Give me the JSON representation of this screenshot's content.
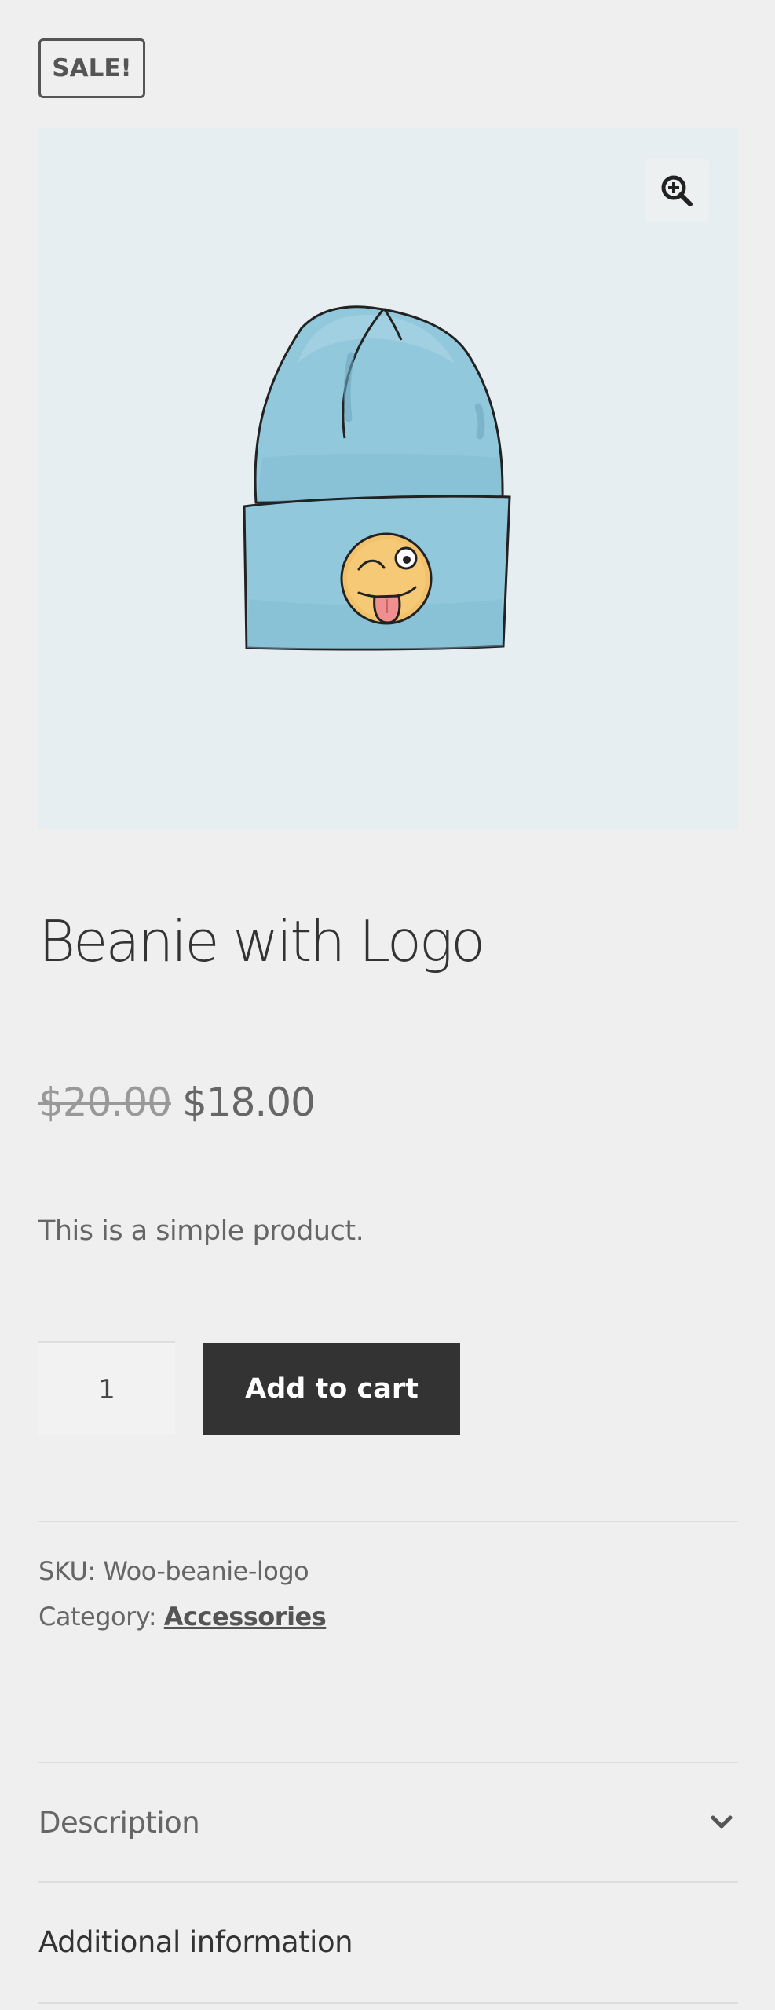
{
  "badge": {
    "sale_label": "SALE!"
  },
  "gallery": {
    "zoom_icon": "zoom-in-icon",
    "image_alt": "Beanie with Logo"
  },
  "product": {
    "title": "Beanie with Logo",
    "regular_price": "$20.00",
    "sale_price": "$18.00",
    "short_description": "This is a simple product."
  },
  "cart": {
    "quantity": "1",
    "add_to_cart_label": "Add to cart"
  },
  "meta": {
    "sku_label": "SKU:",
    "sku_value": "Woo-beanie-logo",
    "category_label": "Category:",
    "category_value": "Accessories"
  },
  "tabs": [
    {
      "label": "Description",
      "active": true,
      "icon": "chevron-down-icon"
    },
    {
      "label": "Additional information",
      "active": false
    }
  ],
  "colors": {
    "background": "#efefef",
    "button": "#333333",
    "gallery_bg": "#e7eef1",
    "beanie_blue": "#8fc6d9"
  }
}
